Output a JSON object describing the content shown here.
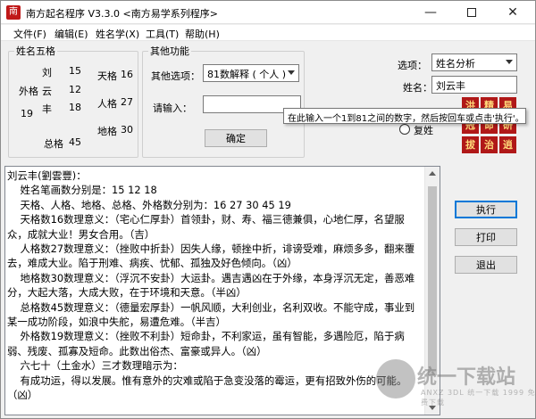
{
  "window": {
    "title": "南方起名程序 V3.3.0   <南方易学系列程序>",
    "icon_text": "南"
  },
  "menu": {
    "items": [
      "文件(F)",
      "编辑(E)",
      "姓名学(X)",
      "工具(T)",
      "帮助(H)"
    ]
  },
  "name_panel": {
    "legend": "姓名五格",
    "chars": [
      "刘",
      "云",
      "丰"
    ],
    "strokes": [
      "15",
      "12",
      "18"
    ],
    "outer_label": "外格",
    "outer_value": "19",
    "tian_label": "天格",
    "tian_value": "16",
    "ren_label": "人格",
    "ren_value": "27",
    "di_label": "地格",
    "di_value": "30",
    "zong_label": "总格",
    "zong_value": "45"
  },
  "func_panel": {
    "legend": "其他功能",
    "option_label": "其他选项：",
    "option_value": "81数解释 ( 个人 )",
    "input_label": "请输入：",
    "input_value": "",
    "confirm_label": "确定"
  },
  "right_panel": {
    "option_label": "选项：",
    "option_value": "姓名分析",
    "name_label": "姓名：",
    "name_value": "刘云丰",
    "radio_single": "单姓",
    "radio_double": "复姓"
  },
  "tooltip": "在此输入一个1到81之间的数字，然后按回车或点击'执行'。",
  "logo_tiles": [
    "洪",
    "精",
    "易",
    "冠",
    "命",
    "研",
    "拔",
    "治",
    "逍"
  ],
  "buttons": {
    "execute": "执行",
    "print": "打印",
    "exit": "退出"
  },
  "result_text": [
    "刘云丰(劉雲豐)：",
    "    姓名笔画数分别是：15 12 18",
    "    天格、人格、地格、总格、外格数分别为：16 27 30 45 19",
    "",
    "    天格数16数理意义：（宅心仁厚卦）首领卦，财、寿、福三德兼俱，心地仁厚，名望服众，成就大业！男女合用。（吉）",
    "    人格数27数理意义：（挫败中折卦）因失人缘，顿挫中折，诽谤受难，麻烦多多，翻来覆去，难成大业。陷于刑难、病疾、忧郁、孤独及好色倾向。（凶）",
    "    地格数30数理意义：（浮沉不安卦）大运卦。遇吉遇凶在于外缘，本身浮沉无定，善恶难分，大起大落，大成大败，在于环境和天意。（半凶）",
    "    总格数45数理意义：（德量宏厚卦）一帆风顺，大利创业，名利双收。不能守成，事业到某一成功阶段，如浪中失舵，易遭危难。（半吉）",
    "    外格数19数理意义：（挫败不利卦）短命卦，不利家运，虽有智能，多遇险厄，陷于病弱、残废、孤寡及短命。此数出俗杰、富豪或异人。（凶）",
    "    六七十（土金水）三才数理暗示为：",
    "    有成功运，得以发展。惟有意外的灾难或陷于急变没落的霉运，更有招致外伤的可能。（凶）"
  ],
  "watermark": {
    "title": "统一下载站",
    "subtitle": "ANXZ 3DL 统一下载 1999 免费下载"
  }
}
